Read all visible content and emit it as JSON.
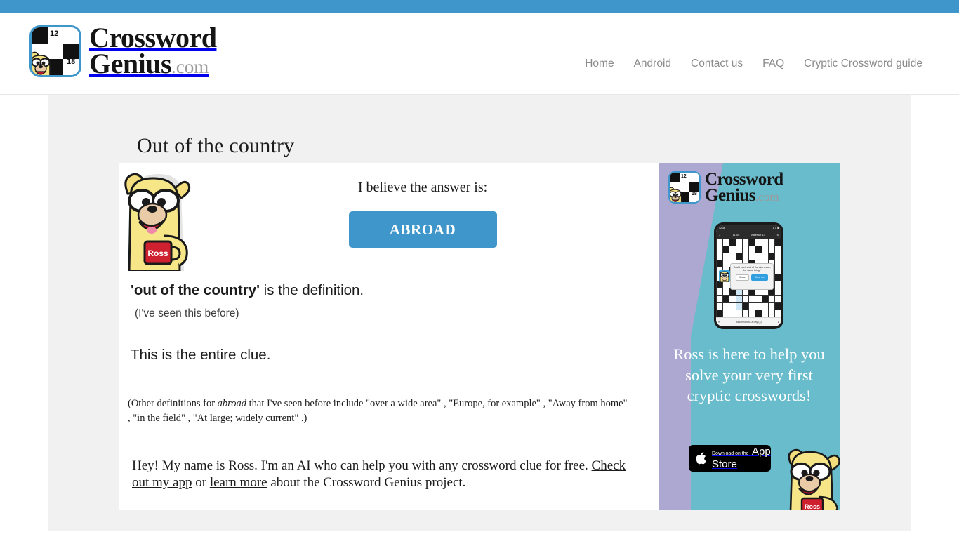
{
  "topbar": {
    "color": "#3f96cb"
  },
  "header": {
    "logo": {
      "name": "crossword-genius-logo",
      "line1": "Crossword",
      "line2": "Genius",
      "suffix": ".com",
      "grid_numbers": [
        "12",
        "18"
      ]
    },
    "nav": [
      {
        "label": "Home",
        "name": "nav-home"
      },
      {
        "label": "Android",
        "name": "nav-android"
      },
      {
        "label": "Contact us",
        "name": "nav-contact-us"
      },
      {
        "label": "FAQ",
        "name": "nav-faq"
      },
      {
        "label": "Cryptic Crossword guide",
        "name": "nav-cryptic-crossword-guide"
      }
    ]
  },
  "page": {
    "title": "Out of the country"
  },
  "answer": {
    "lead": "I believe the answer is:",
    "value": "ABROAD",
    "button_color": "#3f96cb"
  },
  "explanation": {
    "definition_quote": "'out of the country'",
    "definition_tail": " is the definition.",
    "seen_before": "(I've seen this before)",
    "entire_clue": "This is the entire clue.",
    "other_definitions_pre": "(Other definitions for ",
    "other_definitions_word": "abroad",
    "other_definitions_post": " that I've seen before include \"over a wide area\" , \"Europe, for example\" , \"Away from home\" , \"in the field\" , \"At large; widely current\" .)"
  },
  "ross_bio": {
    "part1": "Hey! My name is Ross. I'm an AI who can help you with any crossword clue for free. ",
    "link1": "Check out my app",
    "mid": " or ",
    "link2": "learn more",
    "part2": " about the Crossword Genius project."
  },
  "ad": {
    "background_color": "#69bccb",
    "accent_color": "#aca8d2",
    "logo_line1": "Crossword",
    "logo_line2": "Genius",
    "logo_suffix": ".com",
    "headline": "Ross is here to help you solve your very first cryptic crosswords!",
    "appstore_small": "Download on the",
    "appstore_large": "App Store",
    "phone": {
      "status_left": "12:38",
      "status_right": "● ● ▮",
      "bar_back": "←",
      "bar_title_left": "11:05",
      "bar_title": "Allresult 13",
      "bar_right": "⚙",
      "dialog_text": "Could each end of the clue mean the same thing?",
      "dialog_dismiss": "Close",
      "dialog_confirm": "Show me",
      "footer_left": "≡",
      "footer_center": "Modified less a day (3)",
      "footer_right": "▸"
    }
  },
  "mascot": {
    "name": "Ross",
    "mug_label": "Ross"
  }
}
